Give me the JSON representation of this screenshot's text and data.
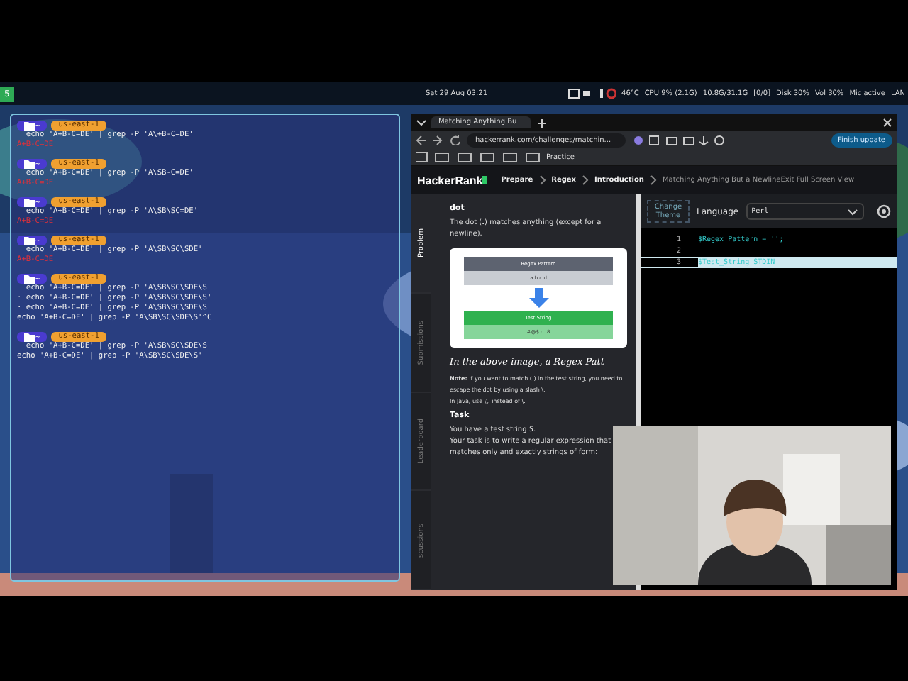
{
  "top_bar": {
    "workspace": "5",
    "clock": "Sat 29 Aug  03:21",
    "indicators": [
      "46°C",
      "CPU 9% (2.1G)",
      "10.8G/31.1G",
      "[0/0]",
      "Disk 30%",
      "Vol 30%",
      "Mic active",
      "LAN"
    ]
  },
  "terminal": {
    "blocks": [
      {
        "dir": "~",
        "region": "us-east-1",
        "lines": [
          "  echo 'A+B-C=DE' | grep -P 'A\\+B-C=DE'"
        ],
        "output": "A+B-C=DE"
      },
      {
        "dir": "~",
        "region": "us-east-1",
        "lines": [
          "  echo 'A+B-C=DE' | grep -P 'A\\SB-C=DE'"
        ],
        "output": "A+B-C=DE"
      },
      {
        "dir": "~",
        "region": "us-east-1",
        "lines": [
          "  echo 'A+B-C=DE' | grep -P 'A\\SB\\SC=DE'"
        ],
        "output": "A+B-C=DE"
      },
      {
        "dir": "~",
        "region": "us-east-1",
        "lines": [
          "  echo 'A+B-C=DE' | grep -P 'A\\SB\\SC\\SDE'"
        ],
        "output": "A+B-C=DE"
      },
      {
        "dir": "~",
        "region": "us-east-1",
        "lines": [
          "  echo 'A+B-C=DE' | grep -P 'A\\SB\\SC\\SDE\\S",
          "· echo 'A+B-C=DE' | grep -P 'A\\SB\\SC\\SDE\\S'",
          "· echo 'A+B-C=DE' | grep -P 'A\\SB\\SC\\SDE\\S",
          "echo 'A+B-C=DE' | grep -P 'A\\SB\\SC\\SDE\\S'^C"
        ]
      },
      {
        "dir": "~",
        "region": "us-east-1",
        "lines": [
          "  echo 'A+B-C=DE' | grep -P 'A\\SB\\SC\\SDE\\S",
          "echo 'A+B-C=DE' | grep -P 'A\\SB\\SC\\SDE\\S'"
        ]
      }
    ]
  },
  "browser": {
    "tab": "Matching Anything Bu",
    "url": "hackerrank.com/challenges/matchin...",
    "bookmark": "Practice",
    "update_button": "Finish update",
    "logo": "HackerRank",
    "breadcrumb": [
      "Prepare",
      "Regex",
      "Introduction",
      "Matching Anything But a NewlineExit Full Screen View"
    ],
    "side_tabs": [
      {
        "label": "Problem",
        "selected": true
      },
      {
        "label": "Submissions",
        "selected": false
      },
      {
        "label": "Leaderboard",
        "selected": false
      },
      {
        "label": "scussions",
        "selected": false
      }
    ],
    "problem": {
      "heading": "dot",
      "intro": "The dot (**.**) matches anything (except for a newline).",
      "diagram": {
        "pattern_label": "Regex Pattern",
        "pattern": "a.b.c.d",
        "string_label": "Test String",
        "string": "#@$.c.!8"
      },
      "caption": "In the above image, a Regex Patt",
      "note": "**Note:** If you want to match (.) in the test string, you need to escape the dot by using a slash \\.",
      "java_note": "In Java, use \\\\. instead of \\.",
      "task_heading": "Task",
      "task_lines": [
        "You have a test string *S*.",
        "Your task is to write a regular expression that matches only and exactly strings of form:"
      ]
    },
    "editor": {
      "theme_button": "Change Theme",
      "language_label": "Language",
      "language": "Perl",
      "lines": [
        {
          "number": "1",
          "code": "$Regex_Pattern = '';",
          "current": false
        },
        {
          "number": "2",
          "current": false
        },
        {
          "number": "3",
          "code": "$Test_String    STDIN",
          "current": true
        }
      ]
    }
  }
}
